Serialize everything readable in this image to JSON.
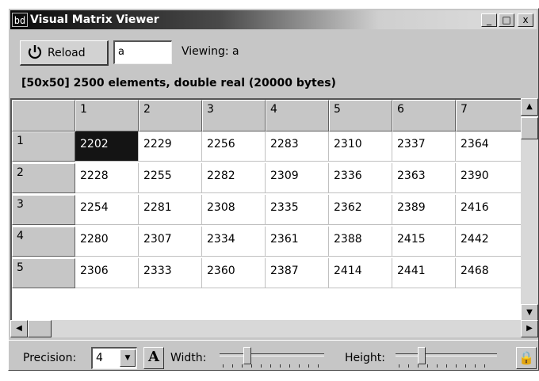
{
  "window": {
    "title": "Visual Matrix Viewer",
    "icon_text": "bd",
    "minimize": "_",
    "maximize": "□",
    "close": "x"
  },
  "toolbar": {
    "reload_label": "Reload",
    "variable_value": "a",
    "viewing_text": "Viewing: a",
    "info": "[50x50] 2500 elements, double real (20000 bytes)"
  },
  "grid": {
    "column_headers": [
      "1",
      "2",
      "3",
      "4",
      "5",
      "6",
      "7"
    ],
    "rows": [
      {
        "header": "1",
        "cells": [
          "2202",
          "2229",
          "2256",
          "2283",
          "2310",
          "2337",
          "2364"
        ]
      },
      {
        "header": "2",
        "cells": [
          "2228",
          "2255",
          "2282",
          "2309",
          "2336",
          "2363",
          "2390"
        ]
      },
      {
        "header": "3",
        "cells": [
          "2254",
          "2281",
          "2308",
          "2335",
          "2362",
          "2389",
          "2416"
        ]
      },
      {
        "header": "4",
        "cells": [
          "2280",
          "2307",
          "2334",
          "2361",
          "2388",
          "2415",
          "2442"
        ]
      },
      {
        "header": "5",
        "cells": [
          "2306",
          "2333",
          "2360",
          "2387",
          "2414",
          "2441",
          "2468"
        ]
      }
    ],
    "selected_cell": "2202"
  },
  "status": {
    "precision_label": "Precision:",
    "precision_value": "4",
    "font_button": "A",
    "width_label": "Width:",
    "height_label": "Height:"
  },
  "icons": {
    "reload": "reload-icon",
    "font": "font-icon",
    "lock": "lock-icon"
  }
}
